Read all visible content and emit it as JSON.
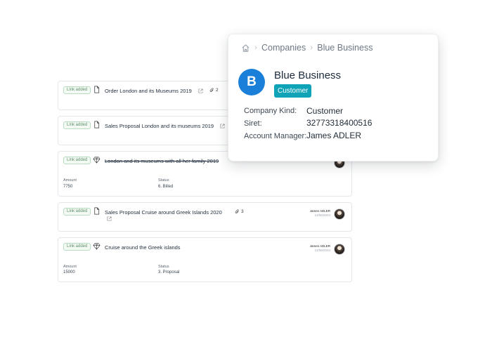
{
  "feed": {
    "items": [
      {
        "badge": "Link added",
        "icon": "document-icon",
        "title": "Order London and its Museums 2019",
        "attachments": "2"
      },
      {
        "badge": "Link added",
        "icon": "document-icon",
        "title": "Sales Proposal London and its museums 2019"
      },
      {
        "badge": "Link added",
        "icon": "diamond-icon",
        "title": "London and its museums with all her family 2019",
        "amount_label": "Amount",
        "amount": "7750",
        "status_label": "Status",
        "status": "6. Billed"
      },
      {
        "badge": "Link added",
        "icon": "document-icon",
        "title": "Sales Proposal Cruise around Greek Islands 2020",
        "attachments": "3",
        "author": "James ADLER",
        "date": "12/06/2024"
      },
      {
        "badge": "Link added",
        "icon": "diamond-icon",
        "title": "Cruise around the Greek islands",
        "author": "James ADLER",
        "date": "12/06/2024",
        "amount_label": "Amount",
        "amount": "15000",
        "status_label": "Status",
        "status": "3. Proposal"
      }
    ]
  },
  "popup": {
    "breadcrumb": {
      "home_icon": "home-icon",
      "section": "Companies",
      "current": "Blue Business"
    },
    "logo_letter": "B",
    "company_name": "Blue Business",
    "kind_badge": "Customer",
    "fields": [
      {
        "label": "Company Kind:",
        "value": "Customer"
      },
      {
        "label": "Siret:",
        "value": "32773318400516"
      },
      {
        "label": "Account Manager:",
        "value": "James ADLER"
      }
    ]
  },
  "colors": {
    "accent_blue": "#1a7fd8",
    "badge_teal": "#0fa3b8",
    "link_badge_green": "#5f8f6a"
  }
}
